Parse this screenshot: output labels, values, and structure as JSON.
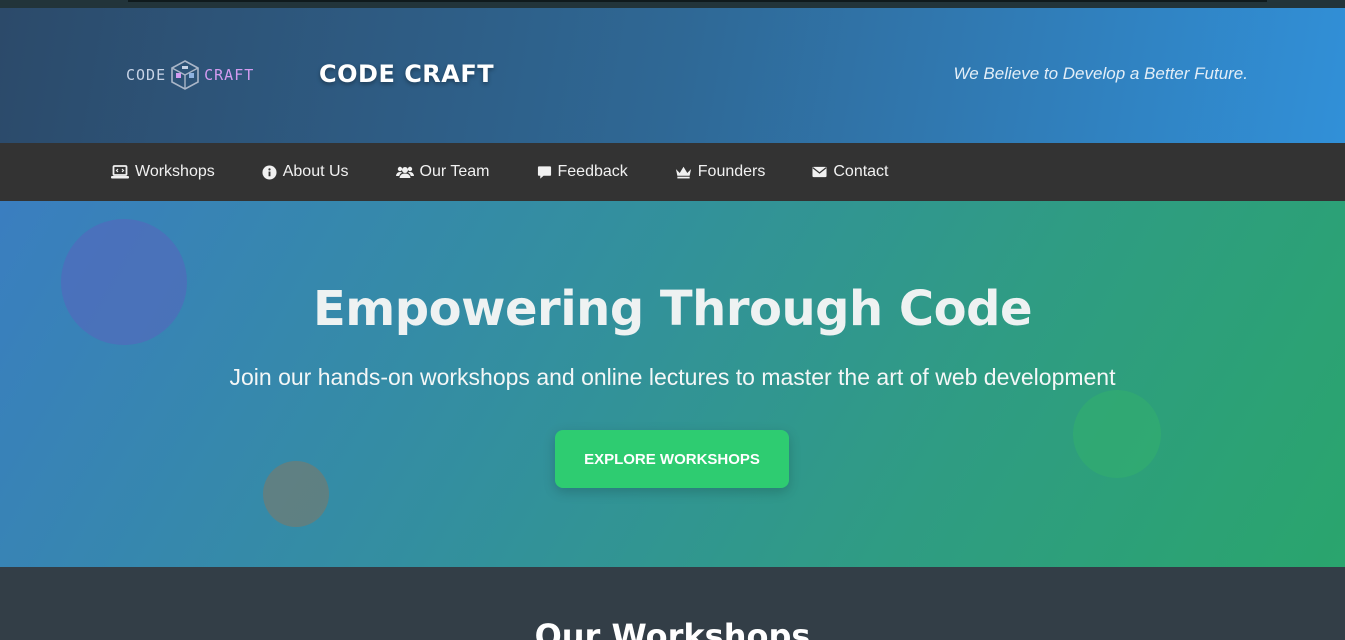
{
  "header": {
    "logo_word_1": "CODE",
    "logo_word_2": "CRAFT",
    "brand": "CODE CRAFT",
    "tagline": "We Believe to Develop a Better Future."
  },
  "nav": {
    "items": [
      {
        "label": "Workshops",
        "icon": "laptop-code-icon"
      },
      {
        "label": "About Us",
        "icon": "info-circle-icon"
      },
      {
        "label": "Our Team",
        "icon": "users-icon"
      },
      {
        "label": "Feedback",
        "icon": "comment-icon"
      },
      {
        "label": "Founders",
        "icon": "crown-icon"
      },
      {
        "label": "Contact",
        "icon": "envelope-icon"
      }
    ]
  },
  "hero": {
    "title": "Empowering Through Code",
    "subtitle": "Join our hands-on workshops and online lectures to master the art of web development",
    "cta_label": "EXPLORE WORKSHOPS"
  },
  "workshops": {
    "heading": "Our Workshops"
  },
  "colors": {
    "accent": "#2ecc71",
    "nav_bg": "#333333",
    "header_start": "#2c4a6a",
    "header_end": "#3190d8"
  }
}
